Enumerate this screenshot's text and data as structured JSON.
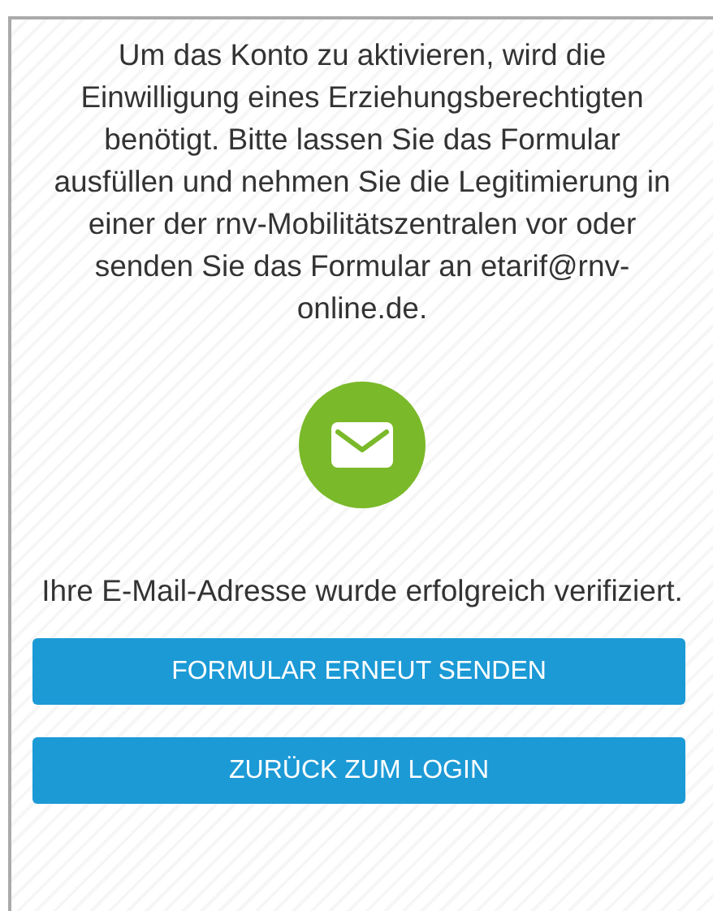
{
  "message": "Um das Konto zu aktivieren, wird die Einwilligung eines Erziehungsberechtigten benötigt. Bitte lassen Sie das Formular ausfüllen und nehmen Sie die Legitimierung in einer der rnv-Mobilitätszentralen vor oder senden Sie das Formular an etarif@rnv-online.de.",
  "status": "Ihre E-Mail-Adresse wurde erfolgreich verifiziert.",
  "buttons": [
    "FORMULAR ERNEUT SENDEN",
    "ZURÜCK ZUM LOGIN"
  ]
}
